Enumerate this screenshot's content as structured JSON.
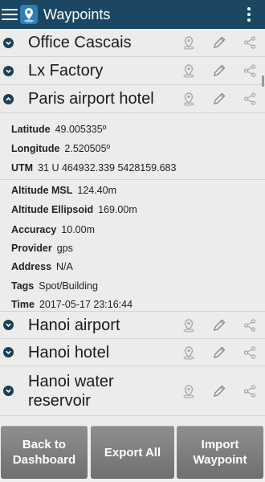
{
  "app": {
    "title": "Waypoints"
  },
  "waypoints": [
    {
      "name": "Office Cascais",
      "expanded": false
    },
    {
      "name": "Lx Factory",
      "expanded": false
    },
    {
      "name": "Paris airport hotel",
      "expanded": true
    },
    {
      "name": "Hanoi airport",
      "expanded": false
    },
    {
      "name": "Hanoi hotel",
      "expanded": false
    },
    {
      "name": "Hanoi water reservoir",
      "expanded": false
    }
  ],
  "details": {
    "latitude": {
      "label": "Latitude",
      "value": "49.005335º"
    },
    "longitude": {
      "label": "Longitude",
      "value": "2.520505º"
    },
    "utm": {
      "label": "UTM",
      "value": "31 U 464932.339 5428159.683"
    },
    "altitude_msl": {
      "label": "Altitude MSL",
      "value": "124.40m"
    },
    "altitude_ellipsoid": {
      "label": "Altitude Ellipsoid",
      "value": "169.00m"
    },
    "accuracy": {
      "label": "Accuracy",
      "value": "10.00m"
    },
    "provider": {
      "label": "Provider",
      "value": "gps"
    },
    "address": {
      "label": "Address",
      "value": "N/A"
    },
    "tags": {
      "label": "Tags",
      "value": "Spot/Building"
    },
    "time": {
      "label": "Time",
      "value": "2017-05-17 23:16:44"
    }
  },
  "footer": {
    "back_label": "Back to Dashboard",
    "export_label": "Export All",
    "import_label": "Import Waypoint"
  },
  "colors": {
    "appbar": "#1b4763",
    "chevron": "#1d3f57",
    "button": "#7f7f7f"
  },
  "icons": {
    "map_pin": "map-pin-icon",
    "edit": "pencil-icon",
    "share": "share-icon"
  }
}
